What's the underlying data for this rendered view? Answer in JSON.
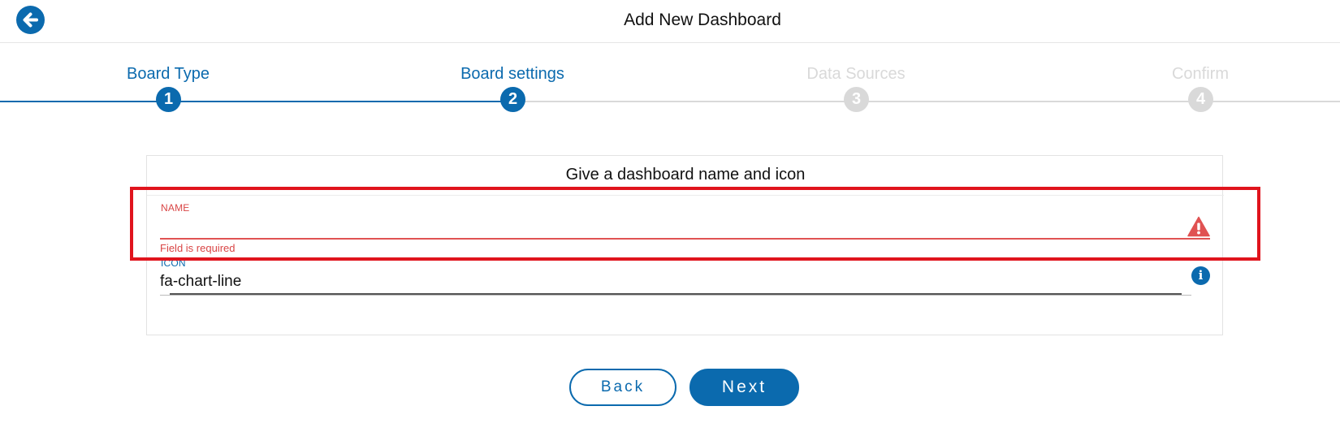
{
  "header": {
    "title": "Add New Dashboard",
    "back_icon": "arrow-left-icon"
  },
  "stepper": {
    "steps": [
      {
        "label": "Board Type",
        "number": "1",
        "state": "completed"
      },
      {
        "label": "Board settings",
        "number": "2",
        "state": "active"
      },
      {
        "label": "Data Sources",
        "number": "3",
        "state": "inactive"
      },
      {
        "label": "Confirm",
        "number": "4",
        "state": "inactive"
      }
    ],
    "active_color": "#0b6aae",
    "inactive_color": "#d9d9d9"
  },
  "form": {
    "title": "Give a dashboard name and icon",
    "name_field": {
      "label": "NAME",
      "value": "",
      "error": "Field is required",
      "error_color": "#e05252",
      "icon": "warning-icon"
    },
    "icon_field": {
      "label": "ICON",
      "value": "fa-chart-line",
      "icon": "info-icon",
      "info_glyph": "i"
    }
  },
  "buttons": {
    "back_label": "Back",
    "next_label": "Next"
  },
  "highlight_color": "#e0141d"
}
